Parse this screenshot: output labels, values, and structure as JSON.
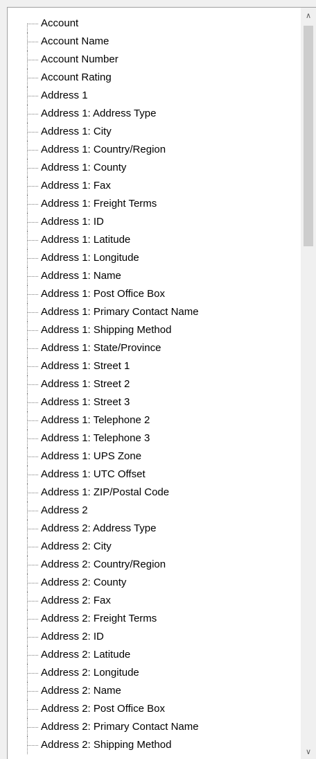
{
  "tree": {
    "items": [
      "Account",
      "Account Name",
      "Account Number",
      "Account Rating",
      "Address 1",
      "Address 1: Address Type",
      "Address 1: City",
      "Address 1: Country/Region",
      "Address 1: County",
      "Address 1: Fax",
      "Address 1: Freight Terms",
      "Address 1: ID",
      "Address 1: Latitude",
      "Address 1: Longitude",
      "Address 1: Name",
      "Address 1: Post Office Box",
      "Address 1: Primary Contact Name",
      "Address 1: Shipping Method",
      "Address 1: State/Province",
      "Address 1: Street 1",
      "Address 1: Street 2",
      "Address 1: Street 3",
      "Address 1: Telephone 2",
      "Address 1: Telephone 3",
      "Address 1: UPS Zone",
      "Address 1: UTC Offset",
      "Address 1: ZIP/Postal Code",
      "Address 2",
      "Address 2: Address Type",
      "Address 2: City",
      "Address 2: Country/Region",
      "Address 2: County",
      "Address 2: Fax",
      "Address 2: Freight Terms",
      "Address 2: ID",
      "Address 2: Latitude",
      "Address 2: Longitude",
      "Address 2: Name",
      "Address 2: Post Office Box",
      "Address 2: Primary Contact Name",
      "Address 2: Shipping Method"
    ]
  },
  "scrollbar": {
    "up_icon": "chevron-up-icon",
    "down_icon": "chevron-down-icon",
    "up_glyph": "∧",
    "down_glyph": "∨",
    "scroll_fraction": 0.0
  }
}
